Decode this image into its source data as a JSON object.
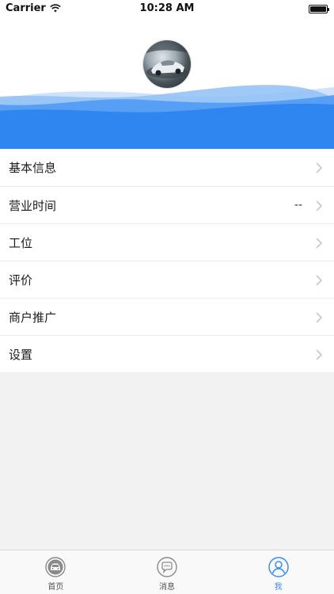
{
  "status_bar": {
    "carrier": "Carrier",
    "time": "10:28 AM"
  },
  "menu": {
    "items": [
      {
        "label": "基本信息",
        "value": ""
      },
      {
        "label": "营业时间",
        "value": "--"
      },
      {
        "label": "工位",
        "value": ""
      },
      {
        "label": "评价",
        "value": ""
      },
      {
        "label": "商户推广",
        "value": ""
      },
      {
        "label": "设置",
        "value": ""
      }
    ]
  },
  "tabbar": {
    "tabs": [
      {
        "label": "首页",
        "icon": "car-icon",
        "active": false
      },
      {
        "label": "消息",
        "icon": "chat-bubble-icon",
        "active": false
      },
      {
        "label": "我",
        "icon": "user-icon",
        "active": true
      }
    ]
  },
  "colors": {
    "accent": "#3b8ff0",
    "wave": "#2f86f0",
    "background": "#f2f2f2"
  }
}
